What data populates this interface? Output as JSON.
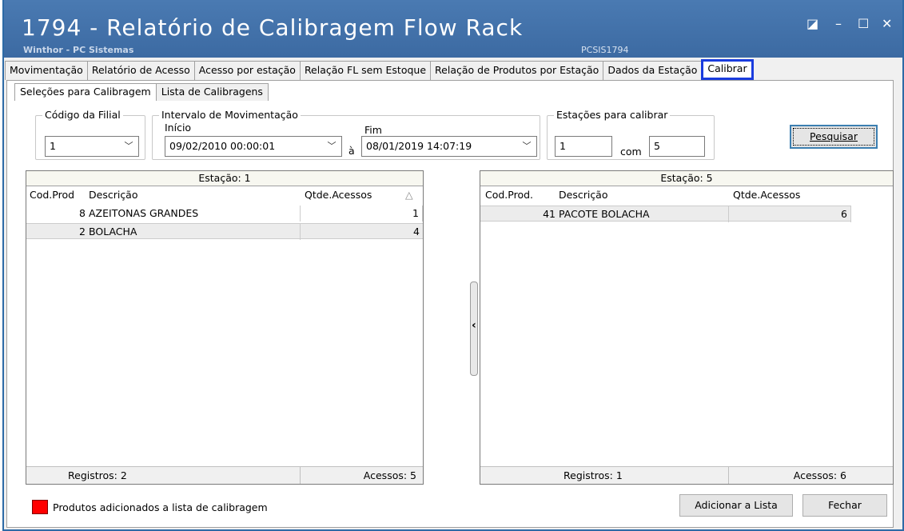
{
  "window": {
    "title": "1794 - Relatório de Calibragem Flow Rack",
    "subtitle": "Winthor - PC Sistemas",
    "code": "PCSIS1794",
    "controls": {
      "restore": "◪",
      "minimize": "–",
      "maximize": "☐",
      "close": "✕"
    }
  },
  "main_tabs": [
    "Movimentação",
    "Relatório de Acesso",
    "Acesso por estação",
    "Relação FL sem Estoque",
    "Relação de Produtos por Estação",
    "Dados da Estação",
    "Calibrar"
  ],
  "sub_tabs": [
    "Seleções para Calibragem",
    "Lista de Calibragens"
  ],
  "filters": {
    "filial_label": "Código da Filial",
    "filial_value": "1",
    "intervalo_label": "Intervalo de Movimentação",
    "inicio_label": "Início",
    "inicio_value": "09/02/2010 00:00:01",
    "a_label": "à",
    "fim_label": "Fim",
    "fim_value": "08/01/2019 14:07:19",
    "estacoes_label": "Estações para calibrar",
    "estacao_de": "1",
    "com_label": "com",
    "estacao_ate": "5",
    "pesquisar_label": "Pesquisar"
  },
  "left_panel": {
    "header": "Estação: 1",
    "columns": [
      "Cod.Prod",
      "Descrição",
      "Qtde.Acessos"
    ],
    "sort_icon": "△",
    "rows": [
      {
        "cod": "8",
        "desc": "AZEITONAS GRANDES",
        "qtde": "1"
      },
      {
        "cod": "2",
        "desc": "BOLACHA",
        "qtde": "4"
      }
    ],
    "registros": "Registros: 2",
    "acessos": "Acessos: 5"
  },
  "right_panel": {
    "header": "Estação: 5",
    "columns": [
      "Cod.Prod.",
      "Descrição",
      "Qtde.Acessos"
    ],
    "rows": [
      {
        "cod": "41",
        "desc": "PACOTE BOLACHA",
        "qtde": "6"
      }
    ],
    "registros": "Registros: 1",
    "acessos": "Acessos: 6"
  },
  "splitter_icon": "‹",
  "legend": {
    "text": "Produtos adicionados a lista de calibragem",
    "color": "#ff0000"
  },
  "buttons": {
    "adicionar": "Adicionar a Lista",
    "fechar": "Fechar"
  }
}
